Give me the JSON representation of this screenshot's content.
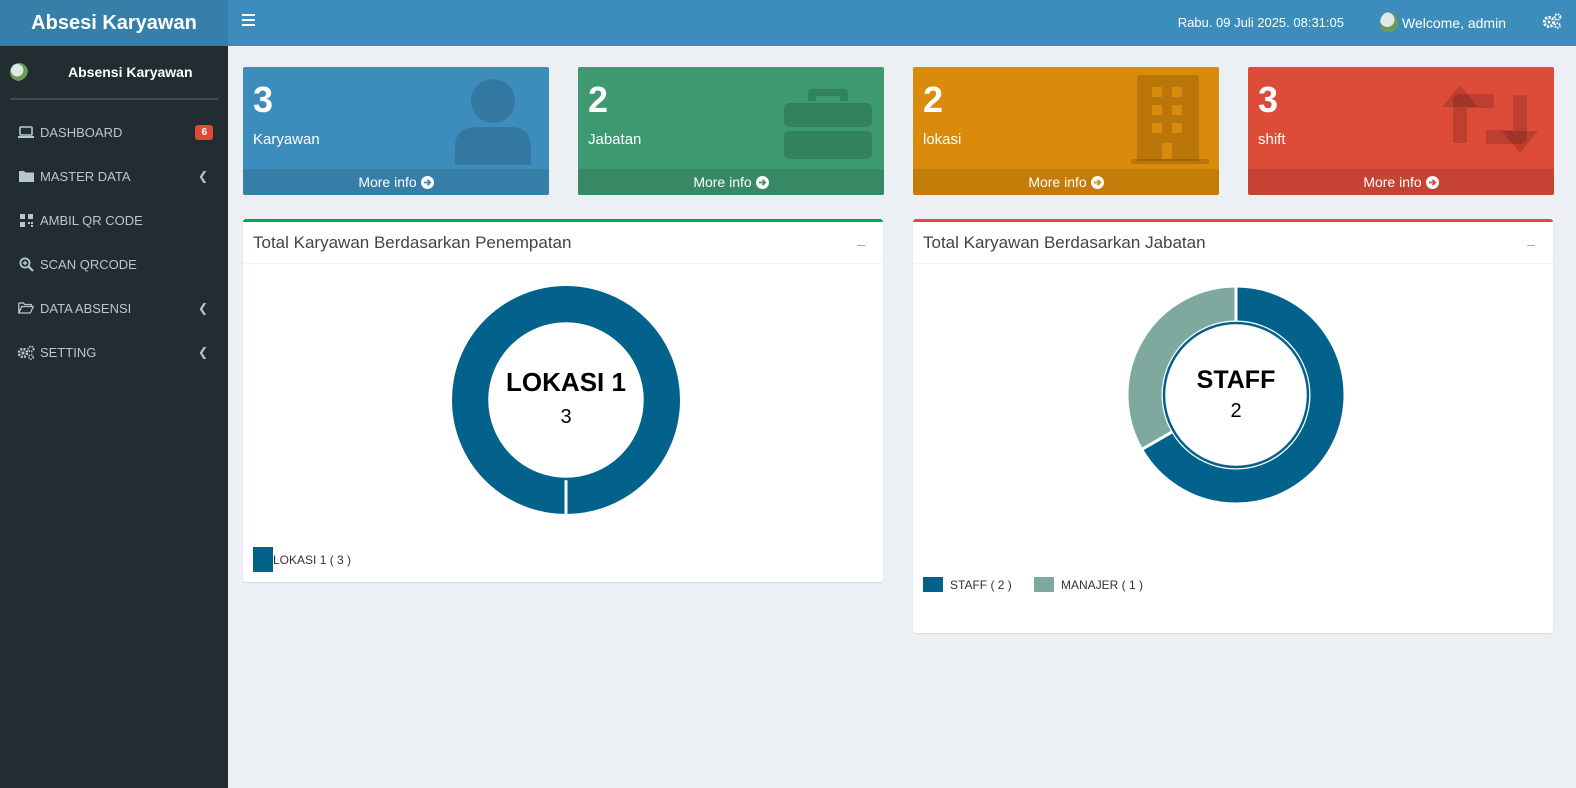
{
  "app": {
    "logo_text": "Absesi Karyawan"
  },
  "sidebar": {
    "user_name": "Absensi Karyawan",
    "items": [
      {
        "label": "DASHBOARD",
        "icon": "laptop-icon",
        "badge": "6"
      },
      {
        "label": "MASTER DATA",
        "icon": "folder-icon"
      },
      {
        "label": "AMBIL QR CODE",
        "icon": "qrcode-icon"
      },
      {
        "label": "SCAN QRCODE",
        "icon": "search-plus-icon"
      },
      {
        "label": "DATA ABSENSI",
        "icon": "folder-open-icon"
      },
      {
        "label": "SETTING",
        "icon": "cogs-icon"
      }
    ]
  },
  "topbar": {
    "datetime": "Rabu. 09 Juli 2025. 08:31:05",
    "welcome": "Welcome, admin"
  },
  "stats": [
    {
      "value": "3",
      "label": "Karyawan",
      "more": "More info",
      "color": "#3c8dbc",
      "icon": "user-icon"
    },
    {
      "value": "2",
      "label": "Jabatan",
      "more": "More info",
      "color": "#3d9970",
      "icon": "briefcase-icon"
    },
    {
      "value": "2",
      "label": "lokasi",
      "more": "More info",
      "color": "#db8b0b",
      "icon": "building-icon"
    },
    {
      "value": "3",
      "label": "shift",
      "more": "More info",
      "color": "#dd4b39",
      "icon": "retweet-icon"
    }
  ],
  "panels": {
    "penempatan": {
      "title": "Total Karyawan Berdasarkan Penempatan",
      "collapse": "–",
      "center_label": "LOKASI 1",
      "center_value": "3",
      "legend": [
        "LOKASI 1 ( 3 )"
      ]
    },
    "jabatan": {
      "title": "Total Karyawan Berdasarkan Jabatan",
      "collapse": "–",
      "center_label": "STAFF",
      "center_value": "2",
      "legend": [
        "STAFF ( 2 )",
        "MANAJER ( 1 )"
      ]
    }
  },
  "chart_data": [
    {
      "type": "pie",
      "title": "Total Karyawan Berdasarkan Penempatan",
      "categories": [
        "LOKASI 1"
      ],
      "values": [
        3
      ],
      "colors": [
        "#03628c"
      ]
    },
    {
      "type": "pie",
      "title": "Total Karyawan Berdasarkan Jabatan",
      "categories": [
        "STAFF",
        "MANAJER"
      ],
      "values": [
        2,
        1
      ],
      "colors": [
        "#03628c",
        "#7fa99f"
      ]
    }
  ]
}
